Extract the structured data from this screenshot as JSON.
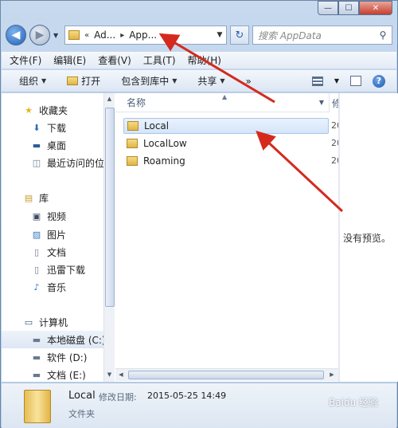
{
  "window": {
    "minimize_glyph": "—",
    "maximize_glyph": "☐",
    "close_glyph": "✕"
  },
  "nav": {
    "back_glyph": "◀",
    "forward_glyph": "▶",
    "crumbs": [
      "«",
      "Ad...",
      "▸",
      "App...",
      "▸"
    ],
    "refresh_glyph": "↻",
    "search_placeholder": "搜索 AppData",
    "search_icon": "search-icon"
  },
  "menubar": [
    "文件(F)",
    "编辑(E)",
    "查看(V)",
    "工具(T)",
    "帮助(H)"
  ],
  "toolbar": {
    "organize": "组织",
    "open": "打开",
    "include_in_library": "包含到库中",
    "share": "共享",
    "more": "»"
  },
  "navpane": {
    "items": [
      {
        "label": "收藏夹",
        "icon": "star-icon",
        "glyph": "★",
        "color": "#e6b422",
        "indent": 0
      },
      {
        "label": "下载",
        "icon": "downloads-icon",
        "glyph": "⬇",
        "color": "#2c6fbd",
        "indent": 1
      },
      {
        "label": "桌面",
        "icon": "desktop-icon",
        "glyph": "▬",
        "color": "#2d5d9a",
        "indent": 1
      },
      {
        "label": "最近访问的位",
        "icon": "recent-places-icon",
        "glyph": "◫",
        "color": "#6a7a8e",
        "indent": 1
      },
      {
        "label": "库",
        "icon": "library-icon",
        "glyph": "▤",
        "color": "#c99a2e",
        "indent": 0
      },
      {
        "label": "视频",
        "icon": "video-icon",
        "glyph": "▣",
        "color": "#3a4a60",
        "indent": 1
      },
      {
        "label": "图片",
        "icon": "pictures-icon",
        "glyph": "▨",
        "color": "#3a7ab8",
        "indent": 1
      },
      {
        "label": "文档",
        "icon": "documents-icon",
        "glyph": "▯",
        "color": "#6b7a90",
        "indent": 1
      },
      {
        "label": "迅雷下载",
        "icon": "thunder-download-icon",
        "glyph": "▯",
        "color": "#6b7a90",
        "indent": 1
      },
      {
        "label": "音乐",
        "icon": "music-icon",
        "glyph": "♪",
        "color": "#2c6fbd",
        "indent": 1
      },
      {
        "label": "计算机",
        "icon": "computer-icon",
        "glyph": "▭",
        "color": "#3a5578",
        "indent": 0
      },
      {
        "label": "本地磁盘 (C:)",
        "icon": "disk-c-icon",
        "glyph": "▬",
        "color": "#6a7a8e",
        "indent": 1,
        "selected": true
      },
      {
        "label": "软件 (D:)",
        "icon": "disk-d-icon",
        "glyph": "▬",
        "color": "#6a7a8e",
        "indent": 1
      },
      {
        "label": "文档 (E:)",
        "icon": "disk-e-icon",
        "glyph": "▬",
        "color": "#6a7a8e",
        "indent": 1
      }
    ]
  },
  "filepane": {
    "col_name": "名称",
    "col_modified": "修",
    "rows": [
      {
        "name": "Local",
        "date": "20",
        "selected": true
      },
      {
        "name": "LocalLow",
        "date": "20",
        "selected": false
      },
      {
        "name": "Roaming",
        "date": "20",
        "selected": false
      }
    ]
  },
  "preview": {
    "no_preview": "没有预览。"
  },
  "details": {
    "name": "Local",
    "modified_label": "修改日期:",
    "modified_value": "2015-05-25 14:49",
    "type": "文件夹"
  },
  "watermark": "Baidu 经验",
  "colors": {
    "annotation_arrow": "#d42a1e",
    "selection": "#d4e5fa",
    "folder": "#e1b547"
  }
}
